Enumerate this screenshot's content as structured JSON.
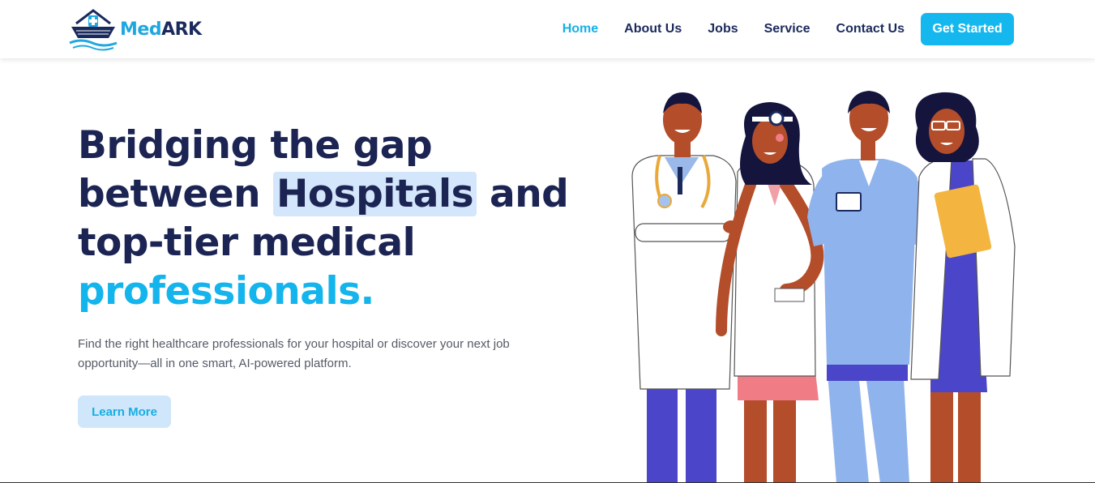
{
  "brand": {
    "part1": "Med",
    "part2": "ARK"
  },
  "nav": {
    "items": [
      {
        "label": "Home",
        "active": true
      },
      {
        "label": "About Us"
      },
      {
        "label": "Jobs"
      },
      {
        "label": "Service"
      },
      {
        "label": "Contact Us"
      }
    ],
    "cta_label": "Get Started"
  },
  "hero": {
    "line1": "Bridging the gap",
    "line2_a": "between ",
    "line2_highlight": "Hospitals",
    "line2_b": " and",
    "line3": "top-tier medical",
    "line4": "professionals.",
    "subtitle": "Find the right healthcare professionals for your hospital or discover your next job opportunity—all in one smart, AI-powered platform.",
    "button_label": "Learn More"
  },
  "colors": {
    "primary": "#14b8ef",
    "navy": "#1b2452",
    "highlight_bg": "#d4e6fb",
    "button_soft_bg": "#cfe6fb"
  }
}
